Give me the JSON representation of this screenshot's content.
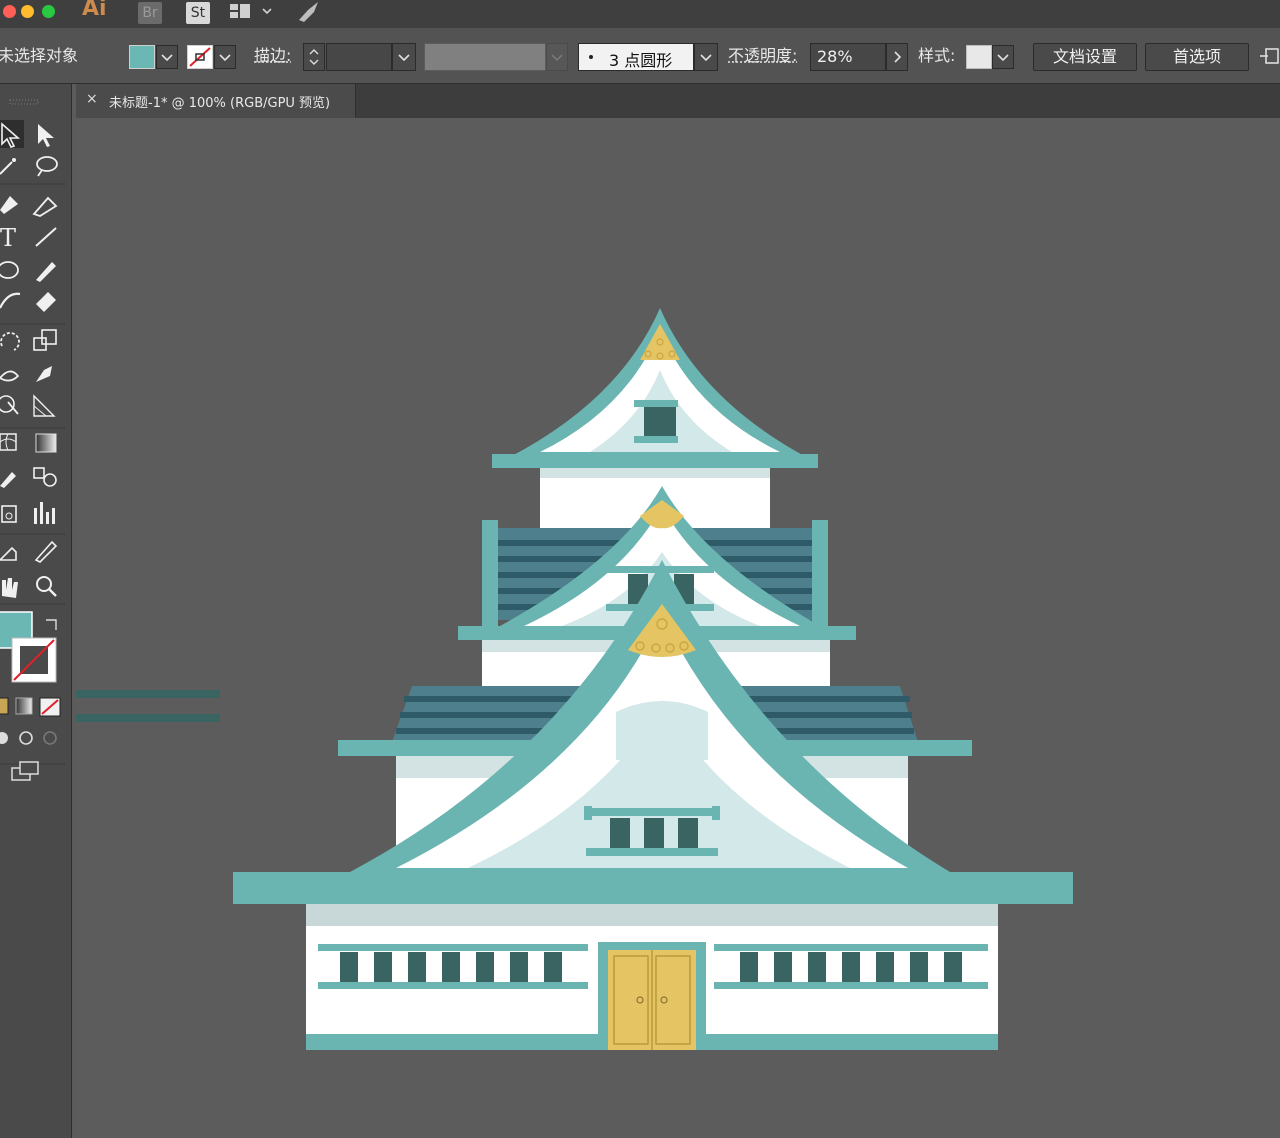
{
  "app": {
    "icons": [
      {
        "name": "ai-app-icon",
        "text": "Ai"
      },
      {
        "name": "bridge-app-icon",
        "text": "Br"
      },
      {
        "name": "stock-app-icon",
        "text": "St"
      },
      {
        "name": "workspace-switcher-icon",
        "text": ""
      },
      {
        "name": "gpu-performance-icon",
        "text": ""
      }
    ],
    "traffic_lights": [
      "#ff5f57",
      "#febc2e",
      "#28c840"
    ]
  },
  "control": {
    "selection_label": "未选择对象",
    "fill_color": "#6ab7b3",
    "stroke_label": "描边:",
    "brush_label": "3 点圆形",
    "opacity_label": "不透明度:",
    "opacity_value": "28%",
    "style_label": "样式:",
    "doc_setup_label": "文档设置",
    "preferences_label": "首选项"
  },
  "document": {
    "tab_title": "未标题-1* @ 100% (RGB/GPU 预览)",
    "close_symbol": "×"
  },
  "toolbar": {
    "tools": [
      "selection-tool",
      "direct-selection-tool",
      "magic-wand-tool",
      "lasso-tool",
      "pen-tool",
      "curvature-tool",
      "type-tool",
      "line-tool",
      "ellipse-tool",
      "paintbrush-tool",
      "shaper-tool",
      "eraser-tool",
      "rotate-tool",
      "scale-tool",
      "warp-tool",
      "puppet-warp-tool",
      "shape-builder-tool",
      "perspective-grid-tool",
      "mesh-tool",
      "gradient-tool",
      "eyedropper-tool",
      "blend-tool",
      "symbol-sprayer-tool",
      "column-graph-tool",
      "artboard-tool",
      "slice-tool",
      "hand-tool",
      "zoom-tool"
    ]
  },
  "artwork": {
    "colors": {
      "teal": "#6ab4b1",
      "white": "#ffffff",
      "pale": "#d3e8e9",
      "dark": "#3a6462",
      "blue": "#4a7d8b",
      "blue_dark": "#2f5866",
      "gold": "#e5c463",
      "gray_stripe": "#c8d8d8"
    }
  }
}
